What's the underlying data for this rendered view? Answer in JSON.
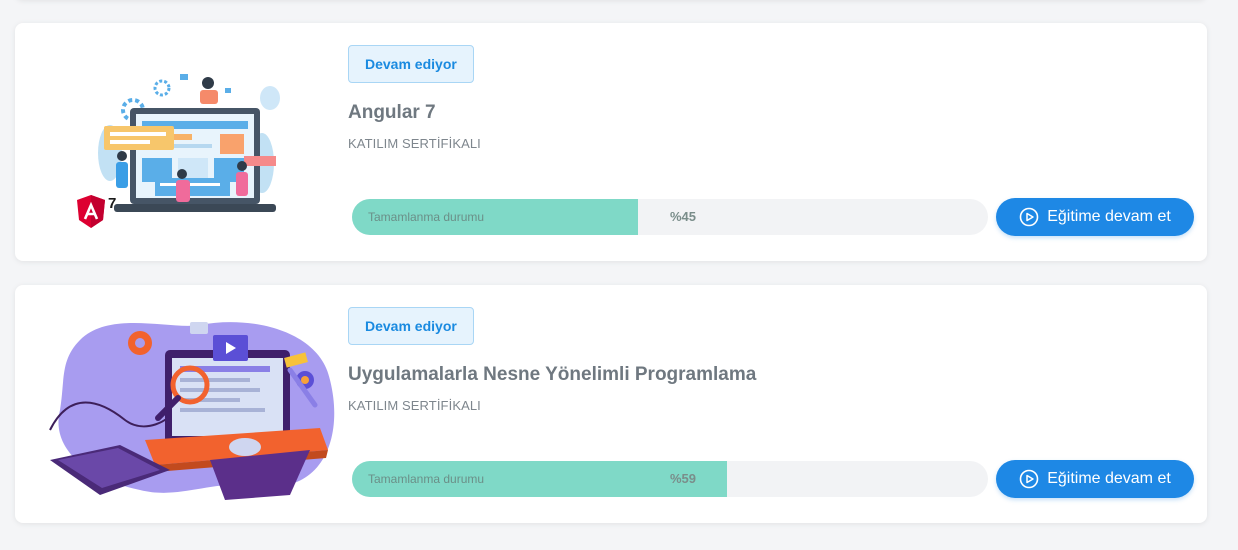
{
  "courses": [
    {
      "status": "Devam ediyor",
      "title": "Angular 7",
      "certificate": "KATILIM SERTİFİKALI",
      "progress_label": "Tamamlanma durumu",
      "progress_percent_text": "%45",
      "progress_value": 45,
      "button_label": "Eğitime devam et",
      "thumbnail_icon": "web-development-illustration",
      "logo_text": "7"
    },
    {
      "status": "Devam ediyor",
      "title": "Uygulamalarla Nesne Yönelimli Programlama",
      "certificate": "KATILIM SERTİFİKALI",
      "progress_label": "Tamamlanma durumu",
      "progress_percent_text": "%59",
      "progress_value": 59,
      "button_label": "Eğitime devam et",
      "thumbnail_icon": "programming-workstation-illustration"
    }
  ],
  "colors": {
    "accent": "#1e88e5",
    "progress_fill": "#7fd9c7",
    "badge_bg": "#e6f3fd",
    "badge_text": "#1a8ae0"
  }
}
